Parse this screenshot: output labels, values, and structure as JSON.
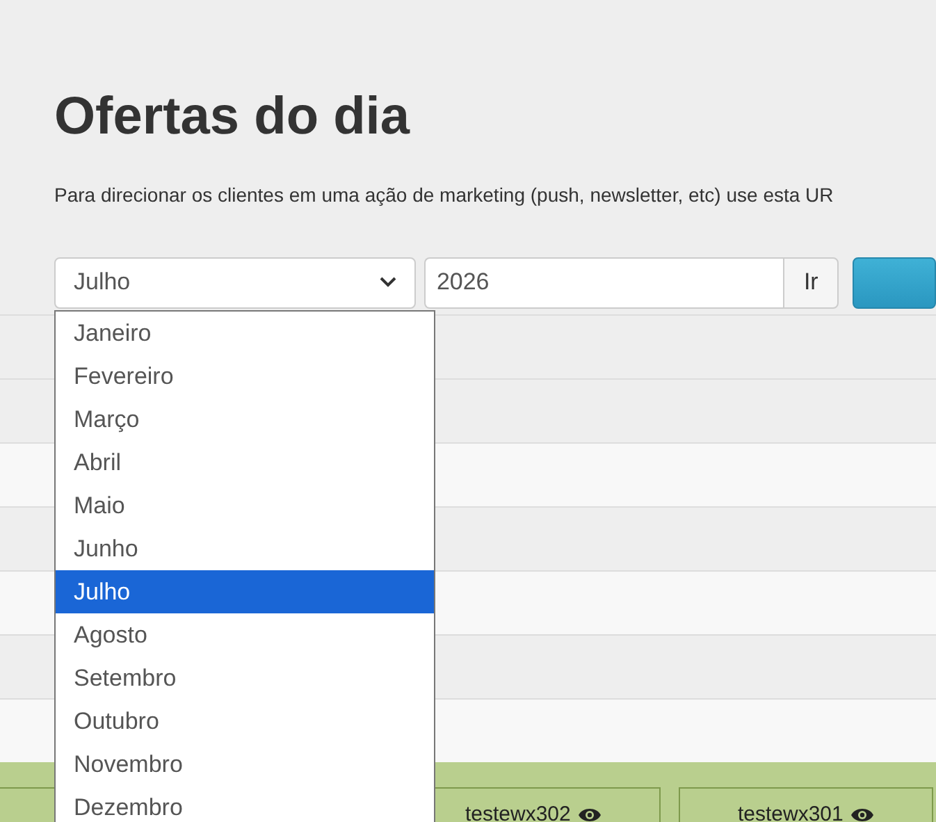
{
  "title": "Ofertas do dia",
  "description": "Para direcionar os clientes em uma ação de marketing (push, newsletter, etc) use esta UR",
  "filter": {
    "month": "Julho",
    "year": "2026",
    "go_button": "Ir"
  },
  "month_dropdown": {
    "expanded": true,
    "options": [
      {
        "label": "Janeiro",
        "selected": false
      },
      {
        "label": "Fevereiro",
        "selected": false
      },
      {
        "label": "Março",
        "selected": false
      },
      {
        "label": "Abril",
        "selected": false
      },
      {
        "label": "Maio",
        "selected": false
      },
      {
        "label": "Junho",
        "selected": false
      },
      {
        "label": "Julho",
        "selected": true
      },
      {
        "label": "Agosto",
        "selected": false
      },
      {
        "label": "Setembro",
        "selected": false
      },
      {
        "label": "Outubro",
        "selected": false
      },
      {
        "label": "Novembro",
        "selected": false
      },
      {
        "label": "Dezembro",
        "selected": false
      }
    ]
  },
  "offer_cells": [
    {
      "label": "testewx302"
    },
    {
      "label": "testewx301"
    }
  ]
}
